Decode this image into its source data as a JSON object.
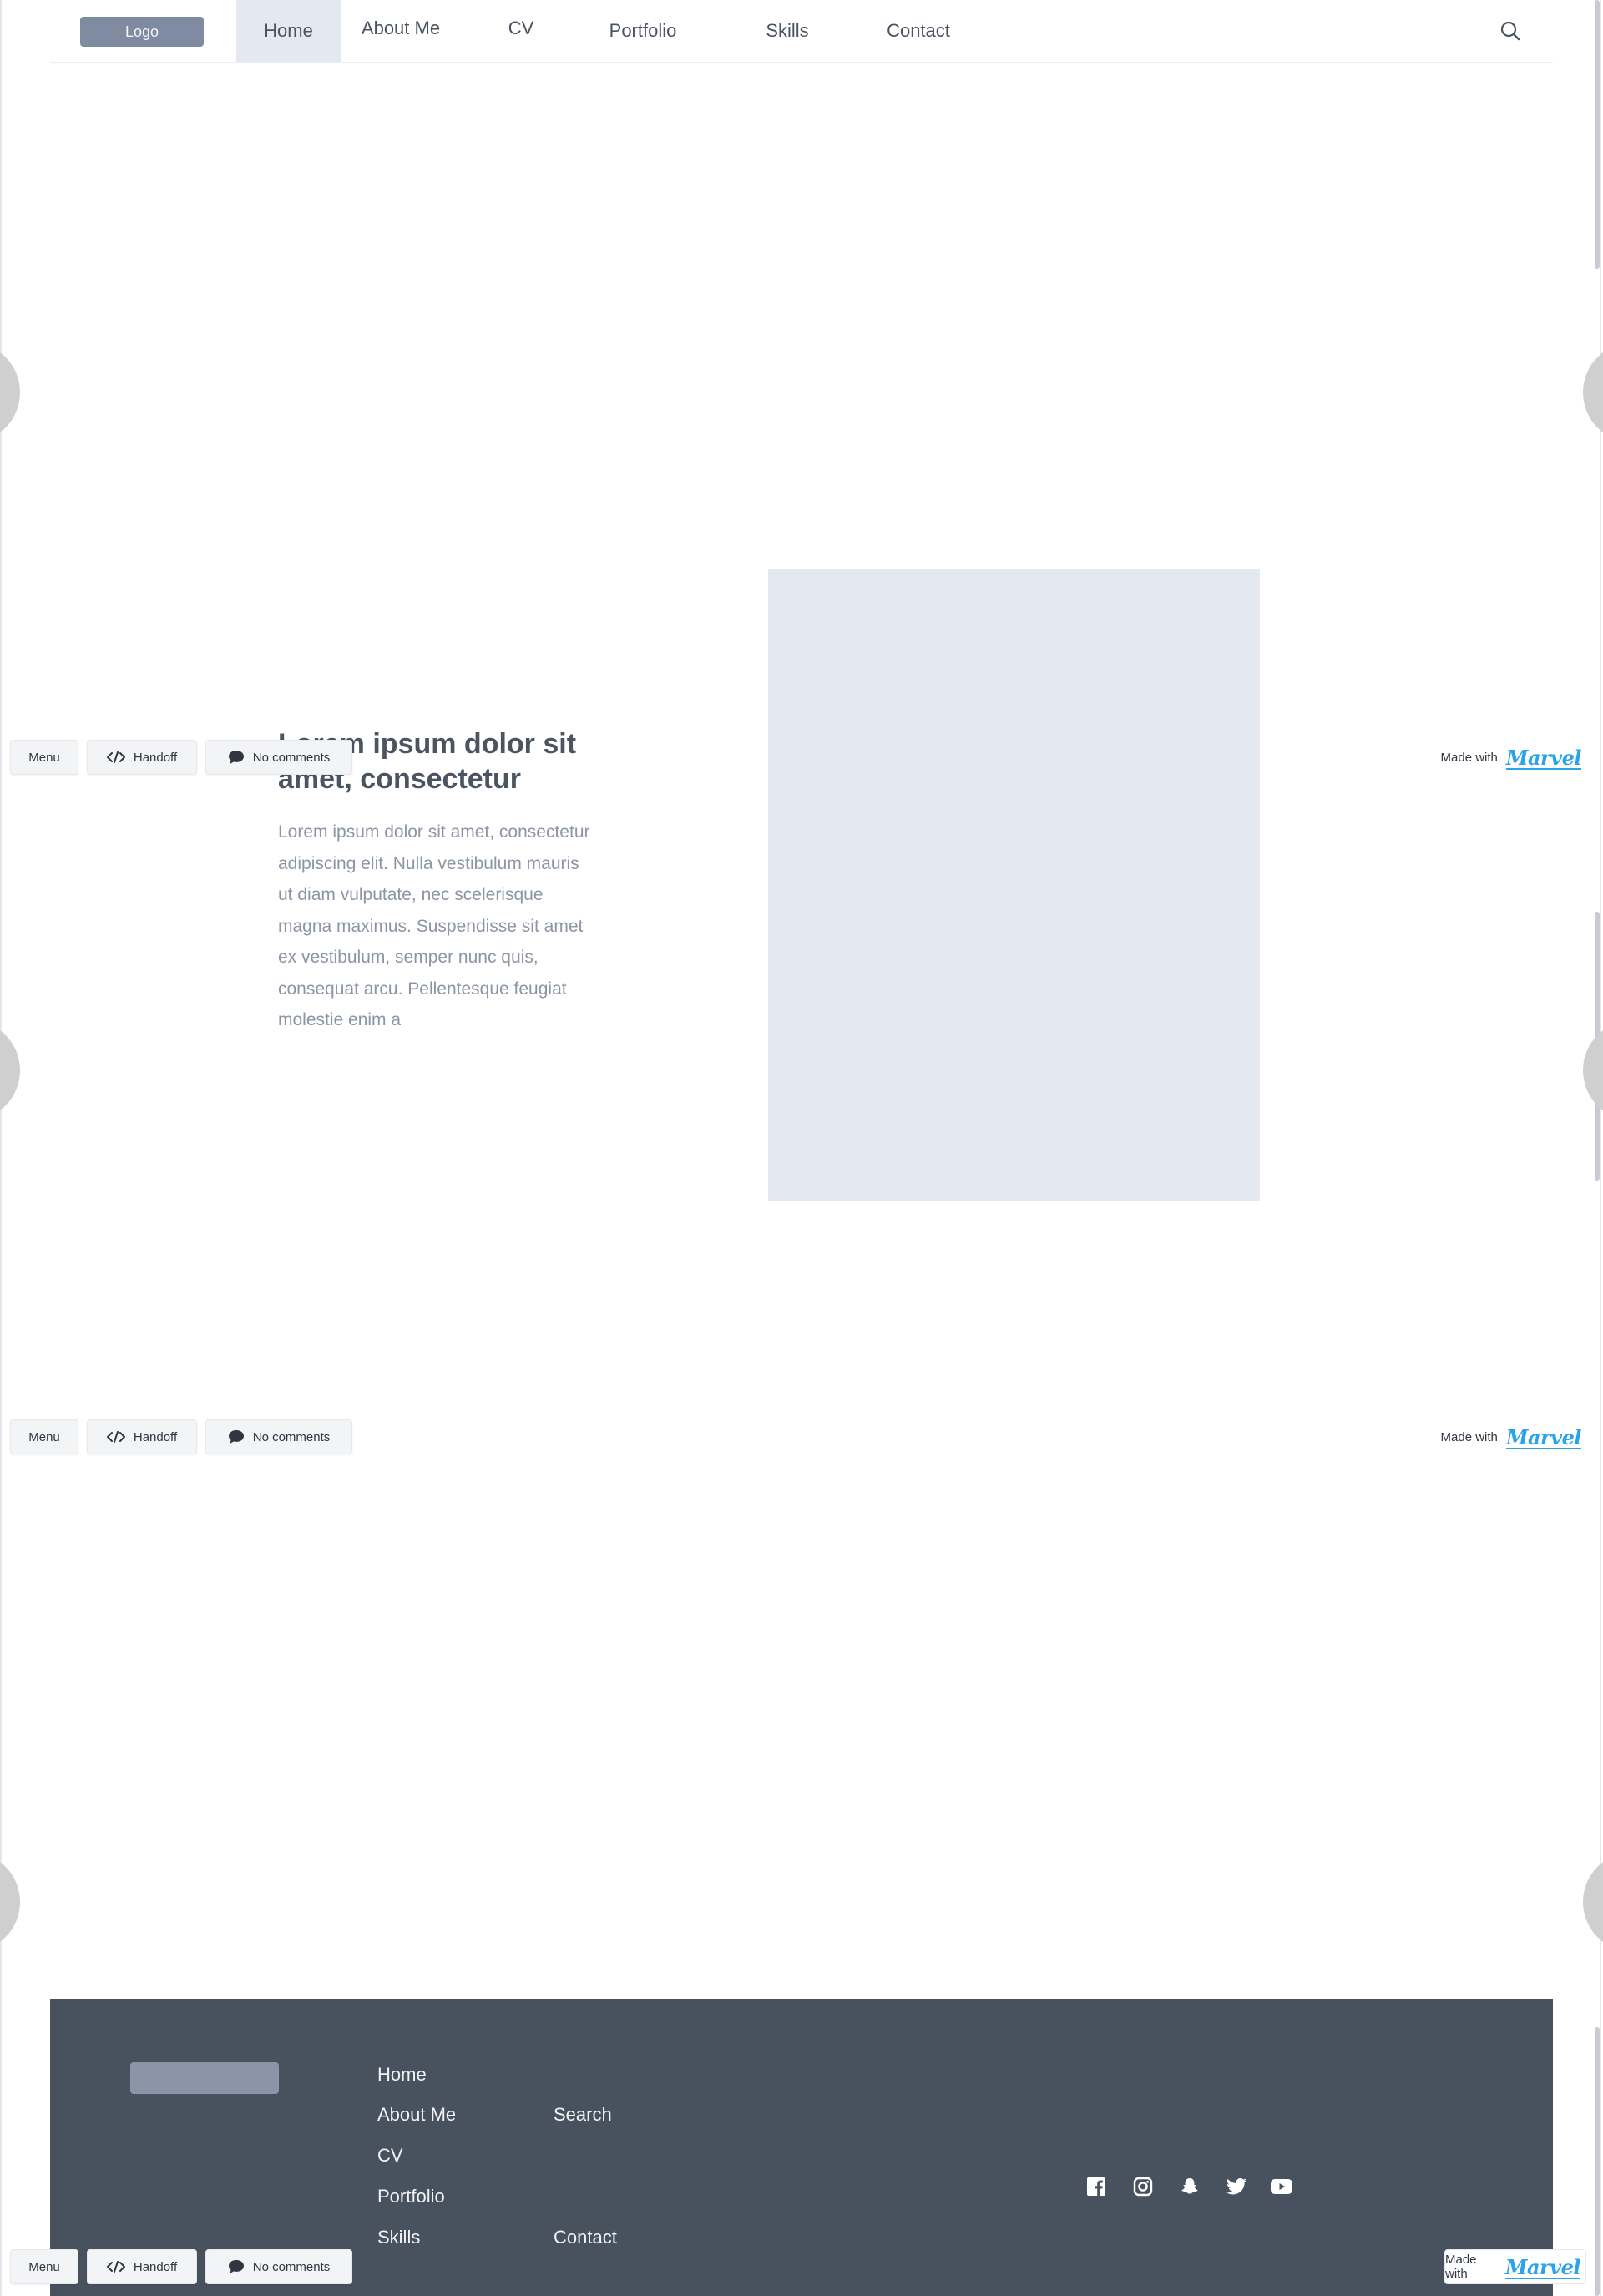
{
  "header": {
    "logo_label": "Logo",
    "nav": [
      {
        "label": "Home",
        "active": true
      },
      {
        "label": "About Me",
        "active": false
      },
      {
        "label": "CV",
        "active": false
      },
      {
        "label": "Portfolio",
        "active": false
      },
      {
        "label": "Skills",
        "active": false
      },
      {
        "label": "Contact",
        "active": false
      }
    ],
    "search_icon": "search-icon"
  },
  "hero": {
    "title": "Lorem ipsum dolor sit amet, consectetur",
    "body": "Lorem ipsum dolor sit amet, consectetur adipiscing elit. Nulla vestibulum mauris ut diam vulputate, nec scelerisque magna maximus. Suspendisse sit amet ex vestibulum, semper nunc quis, consequat arcu. Pellentesque feugiat molestie enim a"
  },
  "toolbar": {
    "menu_label": "Menu",
    "handoff_label": "Handoff",
    "comments_label": "No comments",
    "made_with_label": "Made with",
    "brand": "Marvel"
  },
  "footer": {
    "col1": [
      "Home",
      "About Me",
      "CV",
      "Portfolio",
      "Skills"
    ],
    "col2": [
      "Search",
      "Contact"
    ],
    "social_icons": [
      "facebook-icon",
      "instagram-icon",
      "snapchat-icon",
      "twitter-icon",
      "youtube-icon"
    ]
  },
  "colors": {
    "nav_active_bg": "#e4e8f1",
    "logo_bg": "#7f8ba0",
    "footer_bg": "#48525e",
    "marvel_blue": "#2aa3e8",
    "placeholder": "#e4e8f1"
  }
}
